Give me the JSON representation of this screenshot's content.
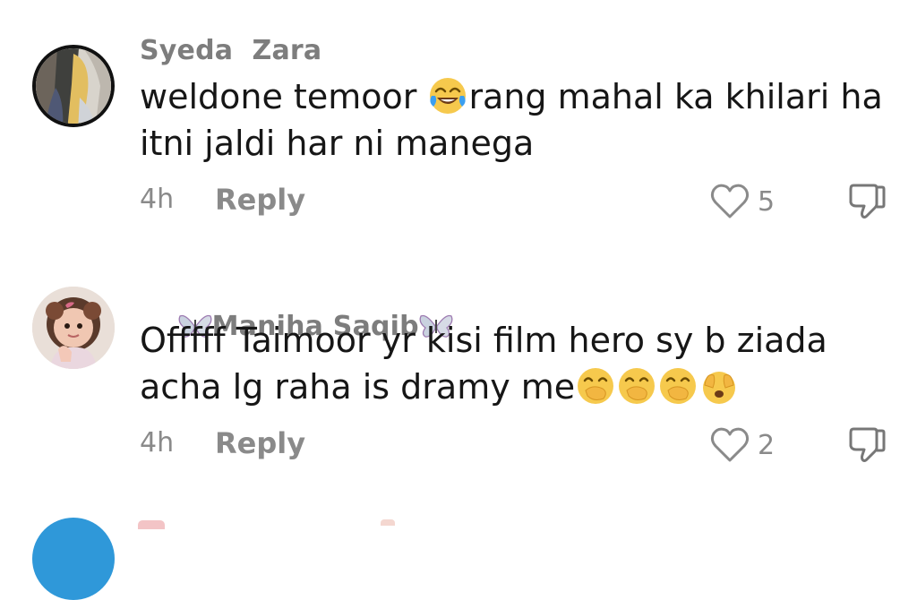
{
  "comments": [
    {
      "username": "Syeda  Zara",
      "text_part1": "weldone temoor ",
      "text_part2": "rang mahal ka khilari ha itni jaldi har ni manega",
      "emojis": [
        "face-with-tears-of-joy"
      ],
      "time": "4h",
      "reply_label": "Reply",
      "likes": "5"
    },
    {
      "username": "Maniha Saqib",
      "username_decoration": "butterfly-icon",
      "text": "Offfff Taimoor yr kisi film hero sy b ziada acha lg raha is dramy me",
      "emojis": [
        "hand-over-mouth",
        "hand-over-mouth",
        "hand-over-mouth",
        "face-with-open-hands"
      ],
      "time": "4h",
      "reply_label": "Reply",
      "likes": "2"
    }
  ],
  "colors": {
    "username": "#7d7d7d",
    "body_text": "#161616",
    "meta_text": "#8a8a8a",
    "next_avatar": "#2f98d9"
  }
}
